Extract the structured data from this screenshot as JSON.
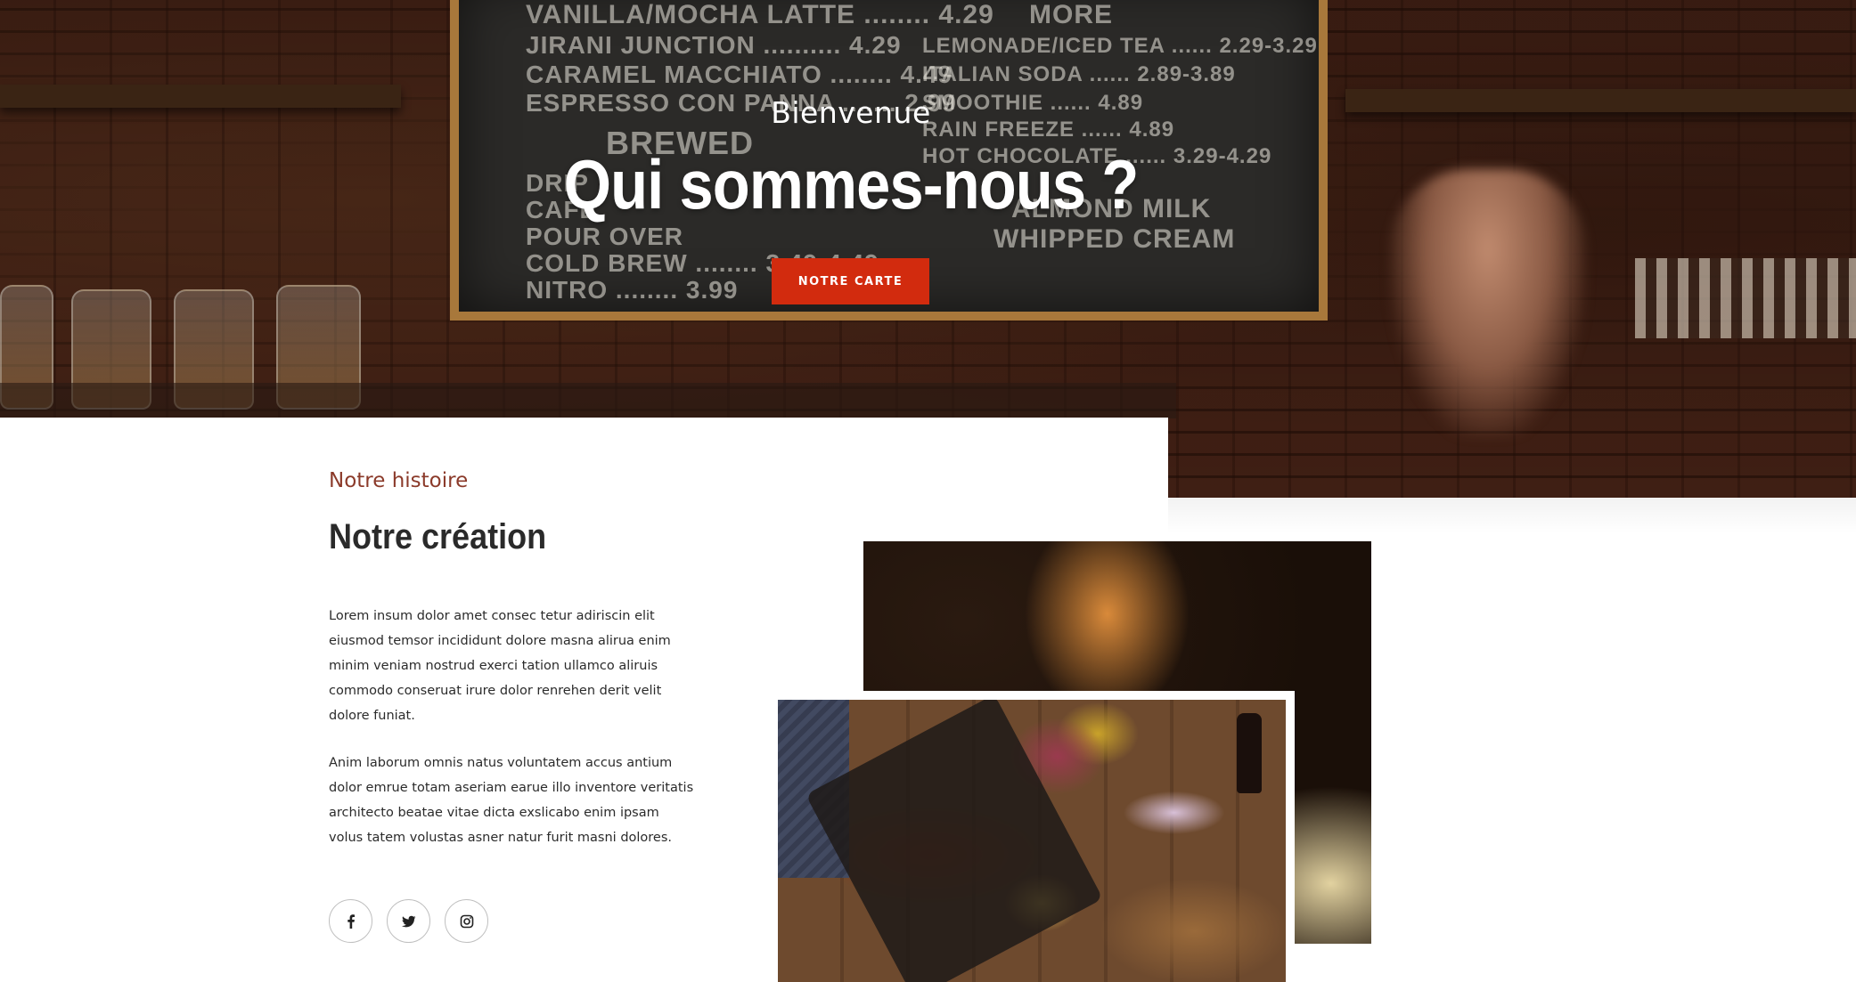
{
  "hero": {
    "welcome": "Bienvenue",
    "title": "Qui sommes-nous ?",
    "button_label": "NOTRE CARTE",
    "background_image": "coffee-shop-chalkboard-photo",
    "chalkboard_lines_left": [
      "VANILLA/MOCHA LATTE ........ 4.29",
      "JIRANI JUNCTION .......... 4.29",
      "CARAMEL MACCHIATO ........ 4.49",
      "ESPRESSO CON PANNA ....... 2.99",
      "BREWED",
      "DRIP",
      "CAFE",
      "POUR OVER",
      "COLD BREW ........ 3.49-4.49",
      "NITRO ........ 3.99"
    ],
    "chalkboard_lines_right": [
      "MORE",
      "LEMONADE/ICED TEA ...... 2.29-3.29",
      "ITALIAN SODA ...... 2.89-3.89",
      "SMOOTHIE ...... 4.89",
      "RAIN FREEZE ...... 4.89",
      "HOT CHOCOLATE ...... 3.29-4.29",
      "ALMOND MILK",
      "WHIPPED CREAM"
    ],
    "accent_color": "#d22b0e"
  },
  "about": {
    "eyebrow": "Notre histoire",
    "title": "Notre création",
    "paragraph1": "Lorem insum dolor amet consec tetur adiriscin elit eiusmod temsor incididunt dolore masna alirua enim minim veniam nostrud exerci tation ullamco aliruis commodo conseruat irure dolor renrehen derit velit dolore funiat.",
    "paragraph2": "Anim laborum omnis natus voluntatem accus antium dolor emrue totam aseriam earue illo inventore veritatis architecto beatae vitae dicta exslicabo enim ipsam volus tatem volustas asner natur furit masni dolores.",
    "eyebrow_color": "#8b3a2a",
    "socials": [
      {
        "name": "facebook",
        "icon": "facebook-icon"
      },
      {
        "name": "twitter",
        "icon": "twitter-icon"
      },
      {
        "name": "instagram",
        "icon": "instagram-icon"
      }
    ]
  },
  "images": {
    "back_photo": "indian-food-dishes-photo",
    "front_photo": "food-platter-table-photo"
  }
}
